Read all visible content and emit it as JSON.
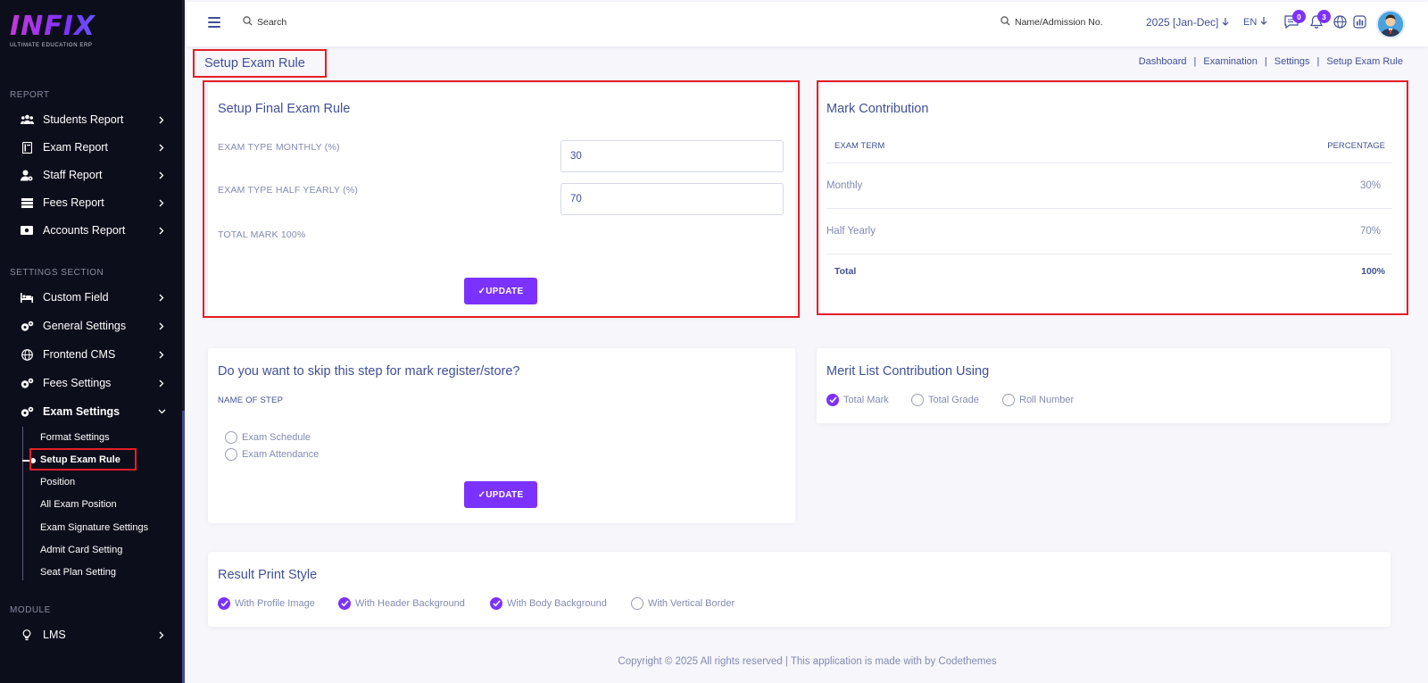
{
  "app": {
    "logo_text": "INFIX",
    "logo_subtitle": "ULTIMATE EDUCATION ERP"
  },
  "sidebar": {
    "report_title": "REPORT",
    "report_items": [
      {
        "label": "Students Report",
        "icon": "users-icon"
      },
      {
        "label": "Exam Report",
        "icon": "book-icon"
      },
      {
        "label": "Staff Report",
        "icon": "user-gear-icon"
      },
      {
        "label": "Fees Report",
        "icon": "list-icon"
      },
      {
        "label": "Accounts Report",
        "icon": "money-icon"
      }
    ],
    "settings_title": "SETTINGS SECTION",
    "settings_items": [
      {
        "label": "Custom Field",
        "icon": "bed-icon"
      },
      {
        "label": "General Settings",
        "icon": "gears-icon"
      },
      {
        "label": "Frontend CMS",
        "icon": "globe-icon"
      },
      {
        "label": "Fees Settings",
        "icon": "gears-icon"
      },
      {
        "label": "Exam Settings",
        "icon": "gears-icon"
      }
    ],
    "exam_sub_items": [
      "Format Settings",
      "Setup Exam Rule",
      "Position",
      "All Exam Position",
      "Exam Signature Settings",
      "Admit Card Setting",
      "Seat Plan Setting"
    ],
    "module_title": "MODULE",
    "module_items": [
      {
        "label": "LMS",
        "icon": "bulb-icon"
      }
    ]
  },
  "topbar": {
    "search_label": "Search",
    "admission_search_label": "Name/Admission No.",
    "session": "2025 [Jan-Dec]",
    "language": "EN",
    "messages_count": "0",
    "notifications_count": "3"
  },
  "page": {
    "title": "Setup Exam Rule",
    "breadcrumb": [
      "Dashboard",
      "Examination",
      "Settings",
      "Setup Exam Rule"
    ]
  },
  "final_rule": {
    "title": "Setup Final Exam Rule",
    "monthly_label": "EXAM TYPE MONTHLY (%)",
    "monthly_value": "30",
    "half_yearly_label": "EXAM TYPE HALF YEARLY (%)",
    "half_yearly_value": "70",
    "total_label": "TOTAL MARK 100%",
    "update_label": "✓UPDATE"
  },
  "mark_contribution": {
    "title": "Mark Contribution",
    "col_term": "EXAM TERM",
    "col_percentage": "PERCENTAGE",
    "rows": [
      {
        "term": "Monthly",
        "percentage": "30%"
      },
      {
        "term": "Half Yearly",
        "percentage": "70%"
      }
    ],
    "total_label": "Total",
    "total_value": "100%"
  },
  "skip_step": {
    "title": "Do you want to skip this step for mark register/store?",
    "name_label": "NAME OF STEP",
    "options": [
      {
        "label": "Exam Schedule",
        "checked": false
      },
      {
        "label": "Exam Attendance",
        "checked": false
      }
    ],
    "update_label": "✓UPDATE"
  },
  "merit_list": {
    "title": "Merit List Contribution Using",
    "options": [
      {
        "label": "Total Mark",
        "checked": true
      },
      {
        "label": "Total Grade",
        "checked": false
      },
      {
        "label": "Roll Number",
        "checked": false
      }
    ]
  },
  "result_print": {
    "title": "Result Print Style",
    "options": [
      {
        "label": "With Profile Image",
        "checked": true
      },
      {
        "label": "With Header Background",
        "checked": true
      },
      {
        "label": "With Body Background",
        "checked": true
      },
      {
        "label": "With Vertical Border",
        "checked": false
      }
    ]
  },
  "footer": {
    "text": "Copyright © 2025 All rights reserved | This application is made with by Codethemes"
  },
  "colors": {
    "accent": "#7c32ff",
    "highlight": "#e41e26",
    "text": "#415094",
    "muted": "#828bb2",
    "sidebar_bg": "#0d0e1b"
  }
}
